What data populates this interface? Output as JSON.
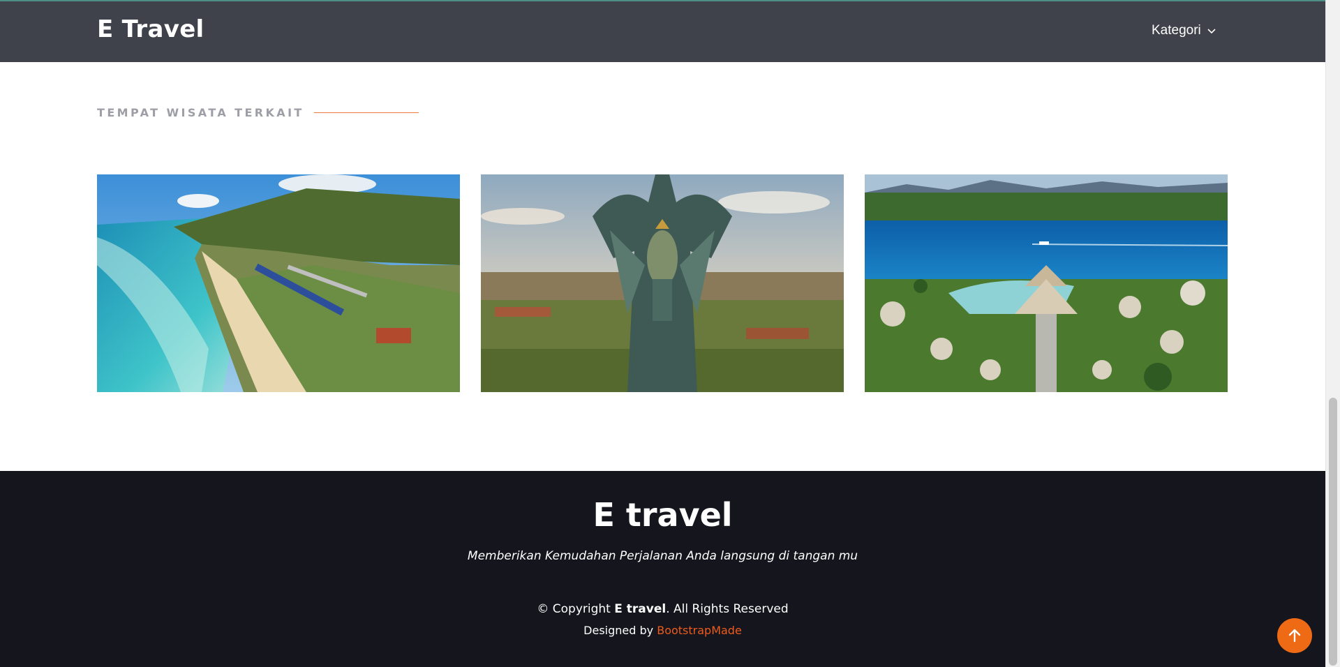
{
  "navbar": {
    "brand": "E Travel",
    "menu_label": "Kategori",
    "menu_icon": "chevron-down-icon"
  },
  "section": {
    "title": "TEMPAT WISATA TERKAIT",
    "accent_color": "#ee7a3c"
  },
  "gallery": [
    {
      "name": "beach-cliff-photo"
    },
    {
      "name": "garuda-statue-photo"
    },
    {
      "name": "lagoon-resort-photo"
    }
  ],
  "footer": {
    "brand": "E travel",
    "tagline": "Memberikan Kemudahan Perjalanan Anda langsung di tangan mu",
    "copyright_prefix": "© Copyright ",
    "copyright_brand": "E travel",
    "copyright_suffix": ". All Rights Reserved",
    "designed_by_prefix": "Designed by ",
    "designed_by_link": "BootstrapMade",
    "link_color": "#ee5b1c"
  },
  "back_to_top": {
    "icon": "arrow-up-icon",
    "color": "#ee6a14"
  }
}
